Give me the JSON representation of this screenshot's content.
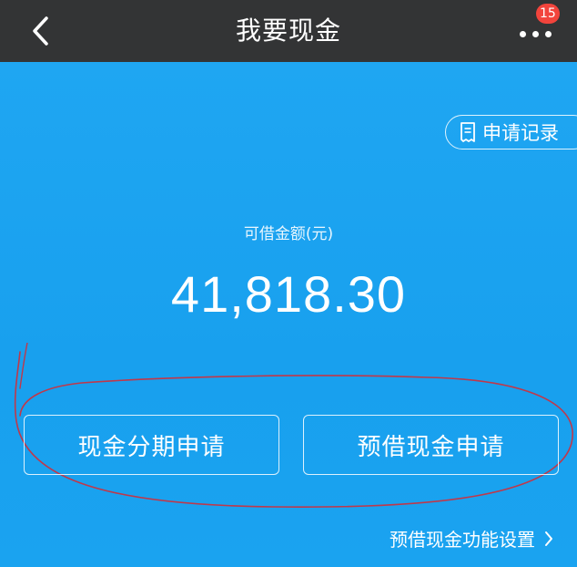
{
  "header": {
    "title": "我要现金",
    "badge_count": "15",
    "back_icon": "chevron-left-icon",
    "more_icon": "more-dots-icon"
  },
  "records": {
    "label": "申请记录",
    "icon": "receipt-icon"
  },
  "balance": {
    "label": "可借金额(元)",
    "amount": "41,818.30"
  },
  "actions": {
    "installment_label": "现金分期申请",
    "advance_label": "预借现金申请"
  },
  "settings": {
    "label": "预借现金功能设置",
    "icon": "chevron-right-icon"
  },
  "colors": {
    "header_bg": "#333435",
    "main_bg": "#1aa3f0",
    "badge_bg": "#f2443c",
    "annotation_stroke": "#c0384a"
  }
}
